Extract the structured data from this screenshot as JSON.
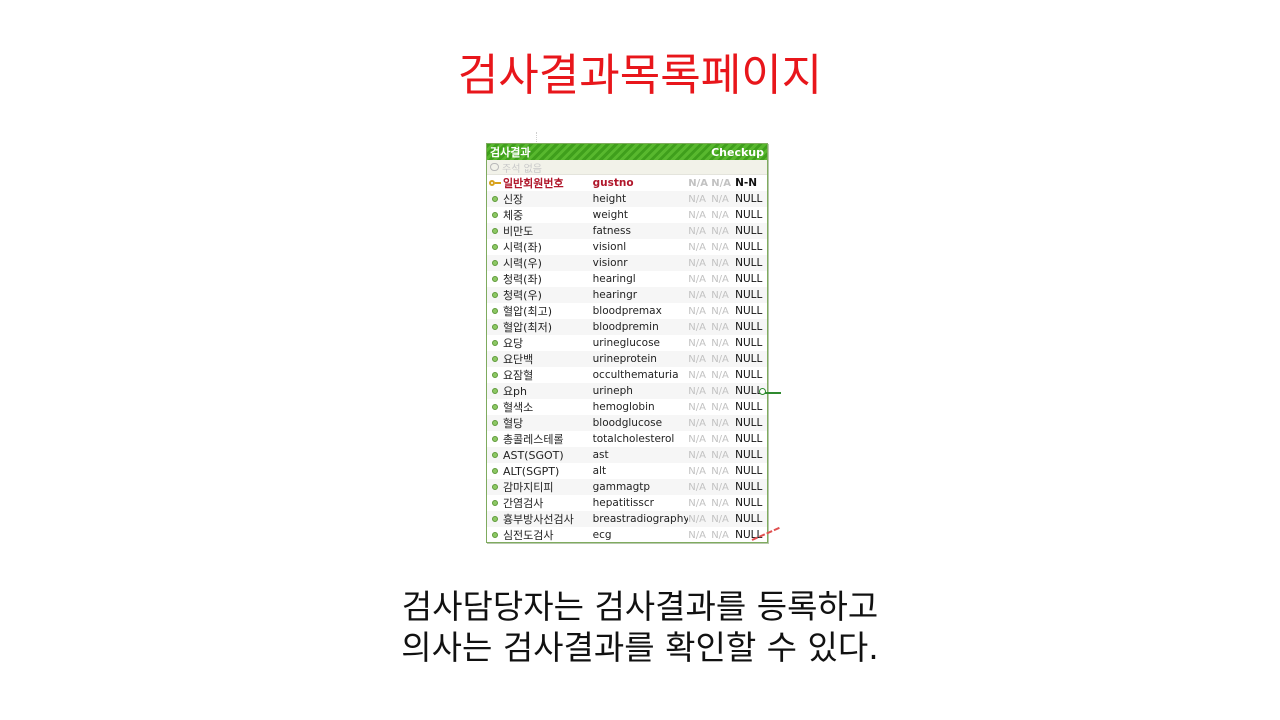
{
  "slide": {
    "title": "검사결과목록페이지",
    "description_line1": "검사담당자는 검사결과를 등록하고",
    "description_line2": "의사는 검사결과를 확인할 수 있다."
  },
  "entity": {
    "logical_name": "검사결과",
    "physical_name": "Checkup",
    "note": "주석 없음",
    "colors": {
      "header": "#3f9f1c",
      "primary_key_text": "#b0172b",
      "title": "#e8161b"
    },
    "columns": [
      {
        "logical": "일반회원번호",
        "physical": "gustno",
        "na1": "N/A",
        "na2": "N/A",
        "null": "N-N",
        "pk": true
      },
      {
        "logical": "신장",
        "physical": "height",
        "na1": "N/A",
        "na2": "N/A",
        "null": "NULL",
        "pk": false
      },
      {
        "logical": "체중",
        "physical": "weight",
        "na1": "N/A",
        "na2": "N/A",
        "null": "NULL",
        "pk": false
      },
      {
        "logical": "비만도",
        "physical": "fatness",
        "na1": "N/A",
        "na2": "N/A",
        "null": "NULL",
        "pk": false
      },
      {
        "logical": "시력(좌)",
        "physical": "visionl",
        "na1": "N/A",
        "na2": "N/A",
        "null": "NULL",
        "pk": false
      },
      {
        "logical": "시력(우)",
        "physical": "visionr",
        "na1": "N/A",
        "na2": "N/A",
        "null": "NULL",
        "pk": false
      },
      {
        "logical": "청력(좌)",
        "physical": "hearingl",
        "na1": "N/A",
        "na2": "N/A",
        "null": "NULL",
        "pk": false
      },
      {
        "logical": "청력(우)",
        "physical": "hearingr",
        "na1": "N/A",
        "na2": "N/A",
        "null": "NULL",
        "pk": false
      },
      {
        "logical": "혈압(최고)",
        "physical": "bloodpremax",
        "na1": "N/A",
        "na2": "N/A",
        "null": "NULL",
        "pk": false
      },
      {
        "logical": "혈압(최저)",
        "physical": "bloodpremin",
        "na1": "N/A",
        "na2": "N/A",
        "null": "NULL",
        "pk": false
      },
      {
        "logical": "요당",
        "physical": "urineglucose",
        "na1": "N/A",
        "na2": "N/A",
        "null": "NULL",
        "pk": false
      },
      {
        "logical": "요단백",
        "physical": "urineprotein",
        "na1": "N/A",
        "na2": "N/A",
        "null": "NULL",
        "pk": false
      },
      {
        "logical": "요잠혈",
        "physical": "occulthematuria",
        "na1": "N/A",
        "na2": "N/A",
        "null": "NULL",
        "pk": false
      },
      {
        "logical": "요ph",
        "physical": "urineph",
        "na1": "N/A",
        "na2": "N/A",
        "null": "NULL",
        "pk": false
      },
      {
        "logical": "혈색소",
        "physical": "hemoglobin",
        "na1": "N/A",
        "na2": "N/A",
        "null": "NULL",
        "pk": false
      },
      {
        "logical": "혈당",
        "physical": "bloodglucose",
        "na1": "N/A",
        "na2": "N/A",
        "null": "NULL",
        "pk": false
      },
      {
        "logical": "총콜레스테롤",
        "physical": "totalcholesterol",
        "na1": "N/A",
        "na2": "N/A",
        "null": "NULL",
        "pk": false
      },
      {
        "logical": "AST(SGOT)",
        "physical": "ast",
        "na1": "N/A",
        "na2": "N/A",
        "null": "NULL",
        "pk": false
      },
      {
        "logical": "ALT(SGPT)",
        "physical": "alt",
        "na1": "N/A",
        "na2": "N/A",
        "null": "NULL",
        "pk": false
      },
      {
        "logical": "감마지티피",
        "physical": "gammagtp",
        "na1": "N/A",
        "na2": "N/A",
        "null": "NULL",
        "pk": false
      },
      {
        "logical": "간염검사",
        "physical": "hepatitisscr",
        "na1": "N/A",
        "na2": "N/A",
        "null": "NULL",
        "pk": false
      },
      {
        "logical": "흉부방사선검사",
        "physical": "breastradiography",
        "na1": "N/A",
        "na2": "N/A",
        "null": "NULL",
        "pk": false
      },
      {
        "logical": "심전도검사",
        "physical": "ecg",
        "na1": "N/A",
        "na2": "N/A",
        "null": "NULL",
        "pk": false
      }
    ]
  }
}
